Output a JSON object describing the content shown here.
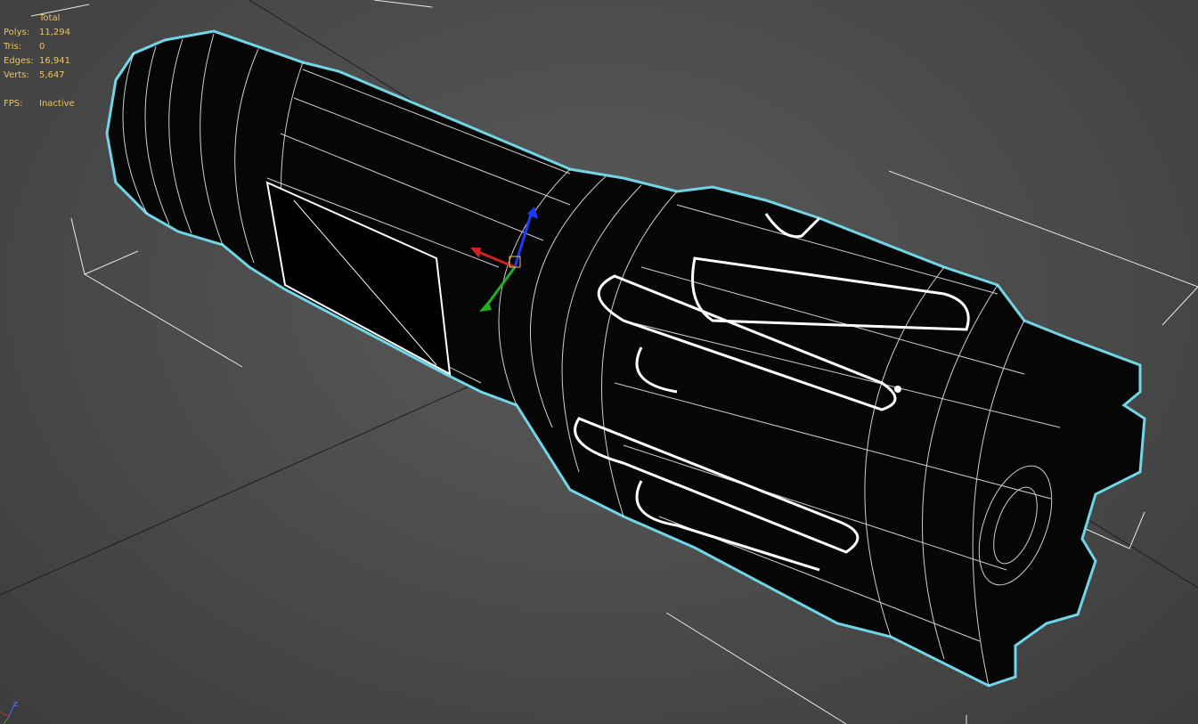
{
  "viewport_stats": {
    "header": "Total",
    "rows": [
      {
        "label": "Polys:",
        "value": "11,294"
      },
      {
        "label": "Tris:",
        "value": "0"
      },
      {
        "label": "Edges:",
        "value": "16,941"
      },
      {
        "label": "Verts:",
        "value": "5,647"
      }
    ],
    "fps_label": "FPS:",
    "fps_value": "Inactive"
  },
  "axis_tripod": {
    "z_label": "z"
  },
  "colors": {
    "viewport_bg": "#4a4a4a",
    "stats_text": "#e6c46a",
    "grid_line": "#1a1a1a",
    "selection_outline": "#6fd6e8",
    "wireframe": "#ffffff",
    "mesh_fill": "#050505"
  }
}
